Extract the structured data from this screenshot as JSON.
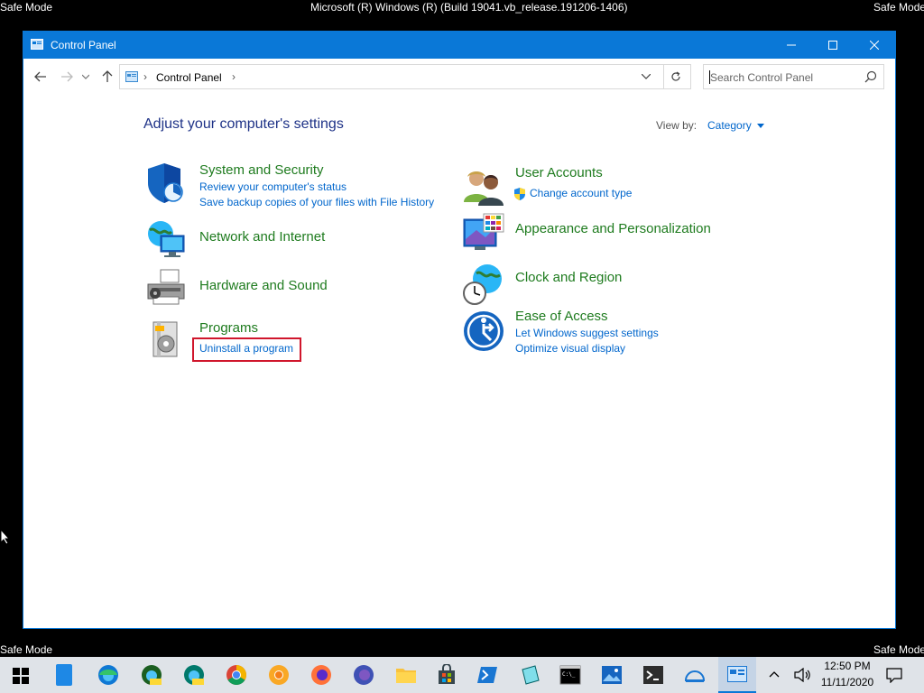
{
  "desktop": {
    "safe_mode_tl": "Safe Mode",
    "safe_mode_tr": "Safe Mode",
    "safe_mode_bl": "Safe Mode",
    "safe_mode_br": "Safe Mode",
    "build_text": "Microsoft (R) Windows (R) (Build 19041.vb_release.191206-1406)"
  },
  "window": {
    "title": "Control Panel",
    "breadcrumb": "Control Panel",
    "search_placeholder": "Search Control Panel"
  },
  "content": {
    "heading": "Adjust your computer's settings",
    "view_by_label": "View by:",
    "view_by_value": "Category",
    "categories_left": [
      {
        "title": "System and Security",
        "links": [
          "Review your computer's status",
          "Save backup copies of your files with File History"
        ]
      },
      {
        "title": "Network and Internet",
        "links": []
      },
      {
        "title": "Hardware and Sound",
        "links": []
      },
      {
        "title": "Programs",
        "links": [
          "Uninstall a program"
        ]
      }
    ],
    "categories_right": [
      {
        "title": "User Accounts",
        "links": [
          "Change account type"
        ]
      },
      {
        "title": "Appearance and Personalization",
        "links": []
      },
      {
        "title": "Clock and Region",
        "links": []
      },
      {
        "title": "Ease of Access",
        "links": [
          "Let Windows suggest settings",
          "Optimize visual display"
        ]
      }
    ]
  },
  "taskbar": {
    "time": "12:50 PM",
    "date": "11/11/2020"
  },
  "colors": {
    "titlebar": "#0a78d7",
    "category_title": "#1e7b1e",
    "link": "#0066cc",
    "highlight": "#d0162c"
  }
}
